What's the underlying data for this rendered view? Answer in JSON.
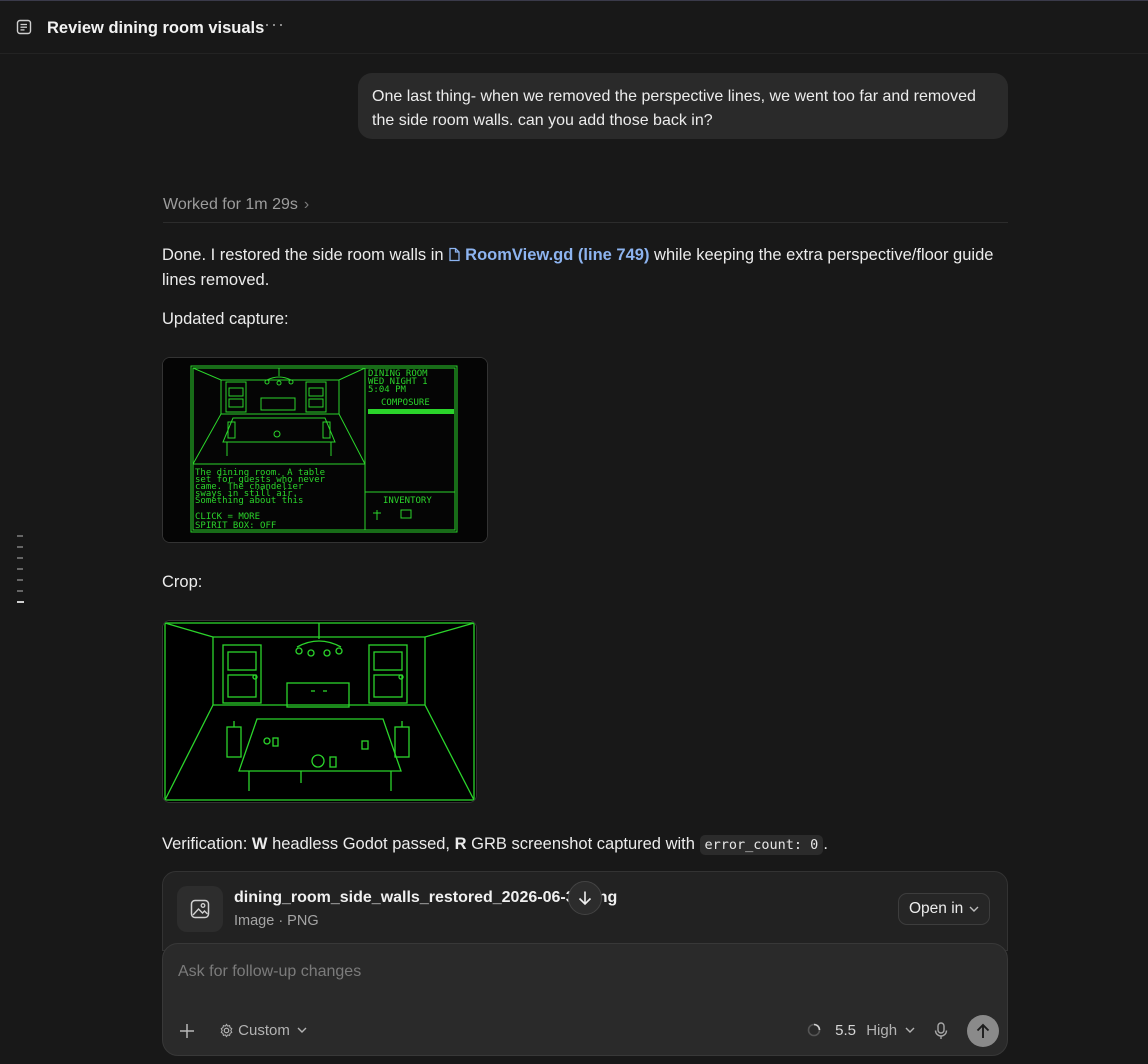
{
  "header": {
    "title": "Review dining room visuals",
    "more_label": "···"
  },
  "user_message": "One last thing- when we removed the perspective lines, we went too far and removed the side room walls. can you add those back in?",
  "worked_label": "Worked for 1m 29s",
  "reply": {
    "p1_before": "Done. I restored the side room walls in",
    "file_link": "RoomView.gd (line 749)",
    "p1_after": "while keeping the extra perspective/floor guide lines removed.",
    "updated_capture": "Updated capture:",
    "crop": "Crop:",
    "verify_prefix": "Verification:",
    "verify_w": "W",
    "verify_mid1": "headless Godot passed,",
    "verify_r": "R",
    "verify_mid2": "GRB screenshot captured with",
    "verify_code": "error_count: 0",
    "verify_end": "."
  },
  "game_screen": {
    "location": "DINING ROOM",
    "day": "WED NIGHT 1",
    "time": "5:04 PM",
    "composure_label": "COMPOSURE",
    "narration": [
      "The dining room. A table",
      "set for guests who never",
      "came. The chandelier",
      "sways in still air.",
      "Something about this"
    ],
    "click_more": "CLICK = MORE",
    "spirit_box": "SPIRIT BOX: OFF",
    "inventory_label": "INVENTORY",
    "phosphor_color": "#2bd42b"
  },
  "attachment": {
    "filename": "dining_room_side_walls_restored_2026-06-30.png",
    "filetype": "Image · PNG",
    "open_in_label": "Open in"
  },
  "composer": {
    "placeholder": "Ask for follow-up changes",
    "mode_label": "Custom",
    "model_version": "5.5",
    "effort_label": "High"
  }
}
